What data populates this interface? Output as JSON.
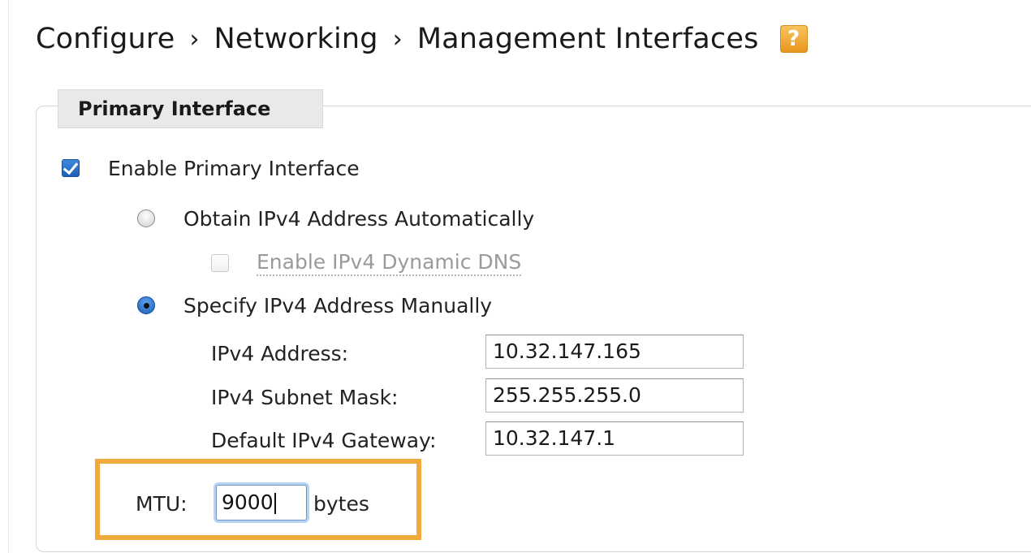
{
  "breadcrumb": {
    "items": [
      "Configure",
      "Networking",
      "Management Interfaces"
    ],
    "separator": "›",
    "help_icon": "help-icon",
    "help_glyph": "?"
  },
  "primary_interface": {
    "legend": "Primary Interface",
    "enable": {
      "label": "Enable Primary Interface",
      "checked": true
    },
    "obtain_auto": {
      "label": "Obtain IPv4 Address Automatically",
      "selected": false
    },
    "dynamic_dns": {
      "label": "Enable IPv4 Dynamic DNS",
      "checked": false,
      "disabled": true
    },
    "specify_manual": {
      "label": "Specify IPv4 Address Manually",
      "selected": true
    },
    "fields": [
      {
        "label": "IPv4 Address:",
        "value": "10.32.147.165"
      },
      {
        "label": "IPv4 Subnet Mask:",
        "value": "255.255.255.0"
      },
      {
        "label": "Default IPv4 Gateway:",
        "value": "10.32.147.1"
      }
    ],
    "mtu": {
      "label": "MTU:",
      "value": "9000",
      "unit": "bytes"
    }
  },
  "colors": {
    "highlight": "#f2a93b",
    "help_icon": "#f0a73a",
    "control_blue": "#1c5fb8"
  }
}
